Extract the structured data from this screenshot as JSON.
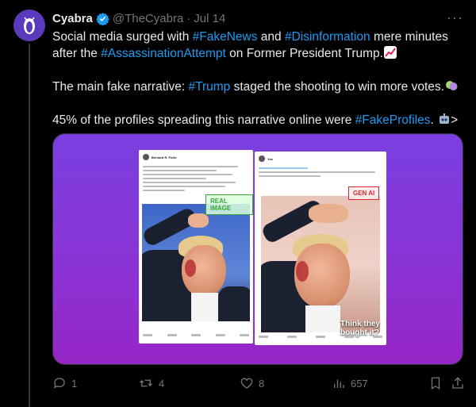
{
  "tweet": {
    "author_name": "Cyabra",
    "handle": "@TheCyabra",
    "separator": "·",
    "date": "Jul 14",
    "more_label": "···",
    "line1": {
      "t1": "Social media surged with ",
      "tag1": "#FakeNews",
      "t2": " and ",
      "tag2": "#Disinformation",
      "t3": " mere minutes after the ",
      "tag3": "#AssassinationAttempt",
      "t4": " on Former President Trump."
    },
    "line2": {
      "t1": "The main fake narrative: ",
      "tag1": "#Trump",
      "t2": " staged the shooting to win more votes."
    },
    "line3": {
      "t1": "45% of the profiles spreading this narrative online were ",
      "tag1": "#FakeProfiles",
      "t2": ". ",
      "t3": ">"
    }
  },
  "media": {
    "left_card": {
      "author": "Bernard R. Forte",
      "badge": "REAL IMAGE"
    },
    "right_card": {
      "author": "Yes",
      "badge": "GEN AI",
      "caption_l1": "Think they",
      "caption_l2": "bought it?"
    }
  },
  "actions": {
    "replies": "1",
    "retweets": "4",
    "likes": "8",
    "views": "657"
  },
  "colors": {
    "link": "#1d9bf0",
    "muted": "#71767b",
    "verified": "#1d9bf0",
    "real_badge": "#3aa53a",
    "gen_badge": "#d8262d"
  }
}
